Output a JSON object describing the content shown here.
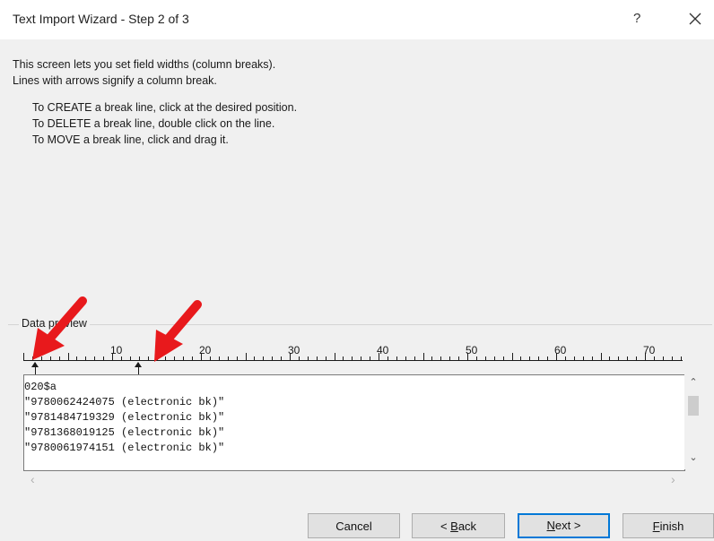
{
  "window": {
    "title": "Text Import Wizard - Step 2 of 3",
    "help_label": "?",
    "close_icon": "close-icon"
  },
  "instructions": {
    "line1": "This screen lets you set field widths (column breaks).",
    "line2": "Lines with arrows signify a column break.",
    "create": "To CREATE a break line, click at the desired position.",
    "delete": "To DELETE a break line, double click on the line.",
    "move": "To MOVE a break line, click and drag it."
  },
  "preview": {
    "label": "Data preview",
    "ruler_numbers": [
      "10",
      "20",
      "30",
      "40",
      "50",
      "60",
      "70"
    ],
    "break_columns": [
      1,
      14
    ],
    "rows": [
      "020$a",
      "\"9780062424075 (electronic bk)\"",
      "\"9781484719329 (electronic bk)\"",
      "\"9781368019125 (electronic bk)\"",
      "\"9780061974151 (electronic bk)\""
    ]
  },
  "buttons": {
    "cancel": "Cancel",
    "back_prefix": "< ",
    "back_mnemonic": "B",
    "back_rest": "ack",
    "next_mnemonic": "N",
    "next_rest": "ext >",
    "finish_mnemonic": "F",
    "finish_rest": "inish"
  },
  "colors": {
    "annotation_arrow": "#e8191c",
    "primary_border": "#0078d7"
  }
}
